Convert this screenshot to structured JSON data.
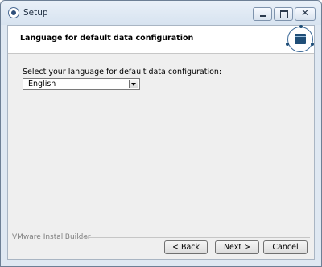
{
  "window": {
    "title": "Setup"
  },
  "header": {
    "title": "Language for default data configuration"
  },
  "form": {
    "prompt": "Select your language for default data configuration:",
    "language_selected": "English"
  },
  "footer": {
    "brand": "VMware InstallBuilder",
    "back_label": "< Back",
    "next_label": "Next >",
    "cancel_label": "Cancel"
  },
  "icons": [
    "app-icon",
    "minimize-icon",
    "maximize-icon",
    "close-icon",
    "installbuilder-logo-icon",
    "dropdown-arrow-icon"
  ]
}
